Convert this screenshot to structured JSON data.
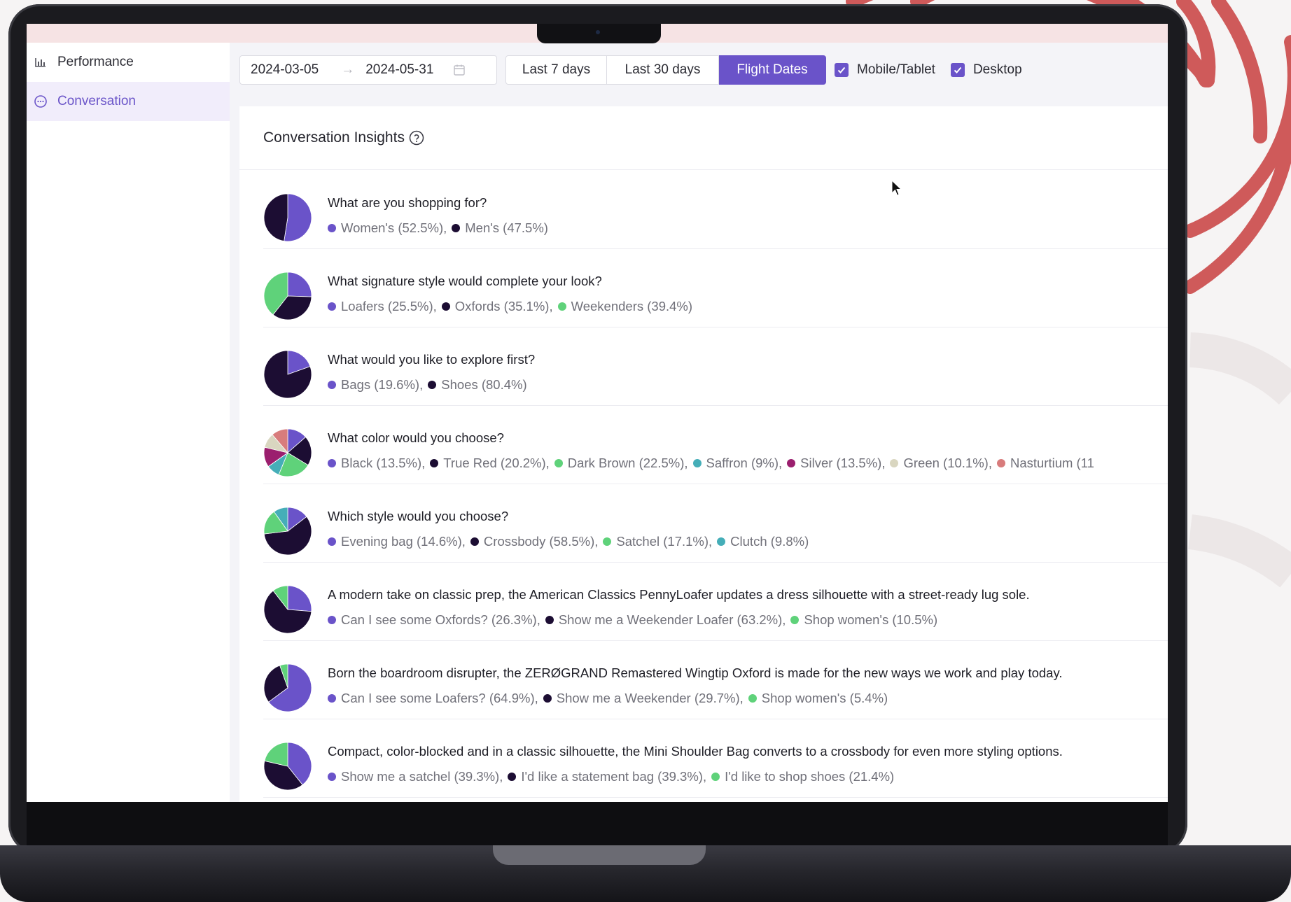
{
  "sidebar": {
    "items": [
      {
        "label": "Performance",
        "icon": "bar-chart-icon",
        "active": false
      },
      {
        "label": "Conversation",
        "icon": "chat-bubble-icon",
        "active": true
      }
    ]
  },
  "toolbar": {
    "date_start": "2024-03-05",
    "date_arrow": "→",
    "date_end": "2024-05-31",
    "range_buttons": [
      "Last 7 days",
      "Last 30 days",
      "Flight Dates"
    ],
    "active_range": "Flight Dates",
    "checkboxes": [
      {
        "label": "Mobile/Tablet",
        "checked": true
      },
      {
        "label": "Desktop",
        "checked": true
      }
    ]
  },
  "card": {
    "title": "Conversation Insights"
  },
  "colors": {
    "purple": "#6a53c9",
    "dark": "#1c0d33",
    "green": "#5fd27a",
    "teal": "#45aeb8",
    "magenta": "#9b1f6e",
    "beige": "#d9d6c0",
    "salmon": "#d87c7c",
    "accent": "#6a53c9",
    "deco_arc": "#cf5a5a"
  },
  "questions": [
    {
      "question": "What are you shopping for?",
      "answers": [
        {
          "label": "Women's",
          "pct": 52.5,
          "text": "Women's (52.5%)",
          "color": "#6a53c9"
        },
        {
          "label": "Men's",
          "pct": 47.5,
          "text": "Men's (47.5%)",
          "color": "#1c0d33"
        }
      ]
    },
    {
      "question": "What signature style would complete your look?",
      "answers": [
        {
          "label": "Loafers",
          "pct": 25.5,
          "text": "Loafers (25.5%)",
          "color": "#6a53c9"
        },
        {
          "label": "Oxfords",
          "pct": 35.1,
          "text": "Oxfords (35.1%)",
          "color": "#1c0d33"
        },
        {
          "label": "Weekenders",
          "pct": 39.4,
          "text": "Weekenders (39.4%)",
          "color": "#5fd27a"
        }
      ]
    },
    {
      "question": "What would you like to explore first?",
      "answers": [
        {
          "label": "Bags",
          "pct": 19.6,
          "text": "Bags (19.6%)",
          "color": "#6a53c9"
        },
        {
          "label": "Shoes",
          "pct": 80.4,
          "text": "Shoes (80.4%)",
          "color": "#1c0d33"
        }
      ]
    },
    {
      "question": "What color would you choose?",
      "answers": [
        {
          "label": "Black",
          "pct": 13.5,
          "text": "Black (13.5%)",
          "color": "#6a53c9"
        },
        {
          "label": "True Red",
          "pct": 20.2,
          "text": "True Red (20.2%)",
          "color": "#1c0d33"
        },
        {
          "label": "Dark Brown",
          "pct": 22.5,
          "text": "Dark Brown (22.5%)",
          "color": "#5fd27a"
        },
        {
          "label": "Saffron",
          "pct": 9,
          "text": "Saffron (9%)",
          "color": "#45aeb8"
        },
        {
          "label": "Silver",
          "pct": 13.5,
          "text": "Silver (13.5%)",
          "color": "#9b1f6e"
        },
        {
          "label": "Green",
          "pct": 10.1,
          "text": "Green (10.1%)",
          "color": "#d9d6c0"
        },
        {
          "label": "Nasturtium",
          "pct": 11.2,
          "text": "Nasturtium (11",
          "color": "#d87c7c"
        }
      ]
    },
    {
      "question": "Which style would you choose?",
      "answers": [
        {
          "label": "Evening bag",
          "pct": 14.6,
          "text": "Evening bag (14.6%)",
          "color": "#6a53c9"
        },
        {
          "label": "Crossbody",
          "pct": 58.5,
          "text": "Crossbody (58.5%)",
          "color": "#1c0d33"
        },
        {
          "label": "Satchel",
          "pct": 17.1,
          "text": "Satchel (17.1%)",
          "color": "#5fd27a"
        },
        {
          "label": "Clutch",
          "pct": 9.8,
          "text": "Clutch (9.8%)",
          "color": "#45aeb8"
        }
      ]
    },
    {
      "question": "A modern take on classic prep, the American Classics PennyLoafer updates a dress silhouette with a street-ready lug sole.",
      "answers": [
        {
          "label": "Can I see some Oxfords?",
          "pct": 26.3,
          "text": "Can I see some Oxfords? (26.3%)",
          "color": "#6a53c9"
        },
        {
          "label": "Show me a Weekender Loafer",
          "pct": 63.2,
          "text": "Show me a Weekender Loafer (63.2%)",
          "color": "#1c0d33"
        },
        {
          "label": "Shop women's",
          "pct": 10.5,
          "text": "Shop women's (10.5%)",
          "color": "#5fd27a"
        }
      ]
    },
    {
      "question": "Born the boardroom disrupter, the ZERØGRAND Remastered Wingtip Oxford is made for the new ways we work and play today.",
      "answers": [
        {
          "label": "Can I see some Loafers?",
          "pct": 64.9,
          "text": "Can I see some Loafers? (64.9%)",
          "color": "#6a53c9"
        },
        {
          "label": "Show me a Weekender",
          "pct": 29.7,
          "text": "Show me a Weekender (29.7%)",
          "color": "#1c0d33"
        },
        {
          "label": "Shop women's",
          "pct": 5.4,
          "text": "Shop women's (5.4%)",
          "color": "#5fd27a"
        }
      ]
    },
    {
      "question": "Compact, color-blocked and in a classic silhouette, the Mini Shoulder Bag converts to a crossbody for even more styling options.",
      "answers": [
        {
          "label": "Show me a satchel",
          "pct": 39.3,
          "text": "Show me a satchel (39.3%)",
          "color": "#6a53c9"
        },
        {
          "label": "I'd like a statement bag",
          "pct": 39.3,
          "text": "I'd like a statement bag (39.3%)",
          "color": "#1c0d33"
        },
        {
          "label": "I'd like to shop shoes",
          "pct": 21.4,
          "text": "I'd like to shop shoes (21.4%)",
          "color": "#5fd27a"
        }
      ]
    }
  ]
}
